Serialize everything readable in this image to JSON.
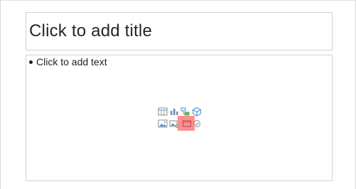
{
  "slide": {
    "title_placeholder": "Click to add title",
    "content_placeholder": "Click to add text"
  },
  "content_icons": [
    {
      "name": "insert-table-icon"
    },
    {
      "name": "insert-chart-icon"
    },
    {
      "name": "insert-smartart-icon"
    },
    {
      "name": "insert-3d-model-icon"
    },
    {
      "name": "insert-pictures-icon"
    },
    {
      "name": "insert-online-pictures-icon"
    },
    {
      "name": "insert-video-icon"
    },
    {
      "name": "insert-icons-icon"
    }
  ],
  "colors": {
    "placeholder_border": "#d2d2d2",
    "icon_blue": "#4a8fd6",
    "icon_gray": "#8d8d8d",
    "highlight": "#ff7b7b"
  }
}
